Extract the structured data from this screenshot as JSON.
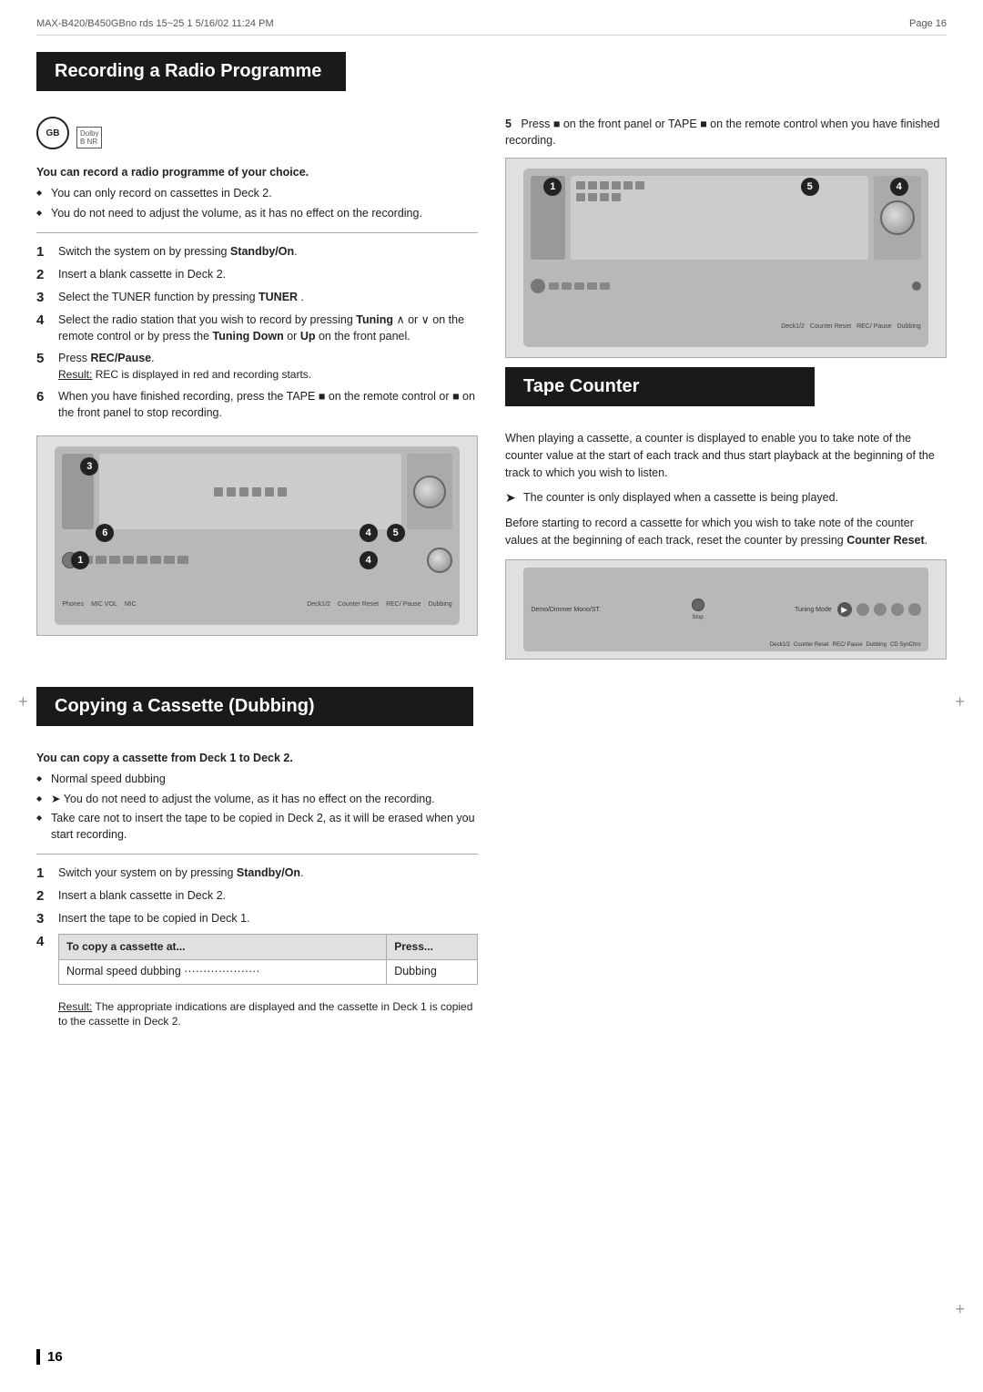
{
  "header": {
    "left": "MAX-B420/B450GBno rds 15~25 1  5/16/02  11:24 PM",
    "right": "Page  16"
  },
  "section1": {
    "title": "Recording a Radio Programme",
    "intro_bold": "You can record a radio programme of your choice.",
    "bullets": [
      "You can only record on cassettes in Deck 2.",
      "You do not need to adjust the volume, as it has no effect on the recording."
    ],
    "steps": [
      {
        "num": "1",
        "text": "Switch the system on by pressing ",
        "bold": "Standby/On",
        "rest": "."
      },
      {
        "num": "2",
        "text": "Insert a blank cassette in Deck 2.",
        "bold": "",
        "rest": ""
      },
      {
        "num": "3",
        "text": "Select the TUNER function by pressing ",
        "bold": "TUNER",
        "rest": " ."
      },
      {
        "num": "4",
        "text": "Select the radio station that you wish to record by pressing ",
        "bold": "Tuning",
        "rest": "  or   on the remote control or by press the ",
        "bold2": "Tuning Down",
        "rest2": " or ",
        "bold3": "Up",
        "rest3": " on the front panel."
      },
      {
        "num": "5",
        "text": "Press ",
        "bold": "REC/Pause",
        "rest": ".",
        "result_label": "Result:",
        "result_text": " REC is displayed in red and recording starts."
      },
      {
        "num": "6",
        "text": "When you have finished recording, press the TAPE ■  on the remote control  or  ■ on the front panel to stop recording."
      }
    ],
    "step5_right": "Press ■ on the front panel or TAPE ■  on the remote control when you have finished recording."
  },
  "section2": {
    "title": "Copying a Cassette (Dubbing)",
    "intro_bold": "You can copy a cassette from Deck 1 to Deck 2.",
    "bullets": [
      "Normal speed dubbing",
      "You do not need to adjust the volume, as it has no effect on the recording.",
      "Take care not to insert the tape to be copied in Deck 2, as it will be erased when you start recording."
    ],
    "steps": [
      {
        "num": "1",
        "text": "Switch your system on by pressing ",
        "bold": "Standby/On",
        "rest": "."
      },
      {
        "num": "2",
        "text": "Insert a blank cassette in Deck 2."
      },
      {
        "num": "3",
        "text": "Insert the tape to be copied in Deck 1."
      }
    ],
    "table_header_col1": "To copy a cassette at...",
    "table_header_col2": "Press...",
    "table_rows": [
      {
        "col1": "Normal speed dubbing ····················",
        "col2": "Dubbing"
      }
    ],
    "result_label": "Result:",
    "result_text": " The appropriate indications are displayed and the cassette in Deck 1 is copied to the cassette in Deck 2."
  },
  "section3": {
    "title": "Tape Counter",
    "intro": "When playing a cassette, a counter is displayed to enable you to take note of the counter value at the start of each track and thus start playback at the beginning of the track to which you wish to listen.",
    "note1": "The counter is only displayed when a cassette is being played.",
    "note2": "Before starting to record a cassette for which you wish to take note of the counter values at the beginning of each track, reset the counter by pressing ",
    "note2_bold": "Counter Reset",
    "note2_rest": "."
  },
  "page_number": "16",
  "callouts": {
    "left_device": [
      "3",
      "6",
      "4",
      "5",
      "4",
      "1"
    ],
    "right_device_top": [
      "1",
      "5",
      "4"
    ],
    "right_device_small": []
  }
}
